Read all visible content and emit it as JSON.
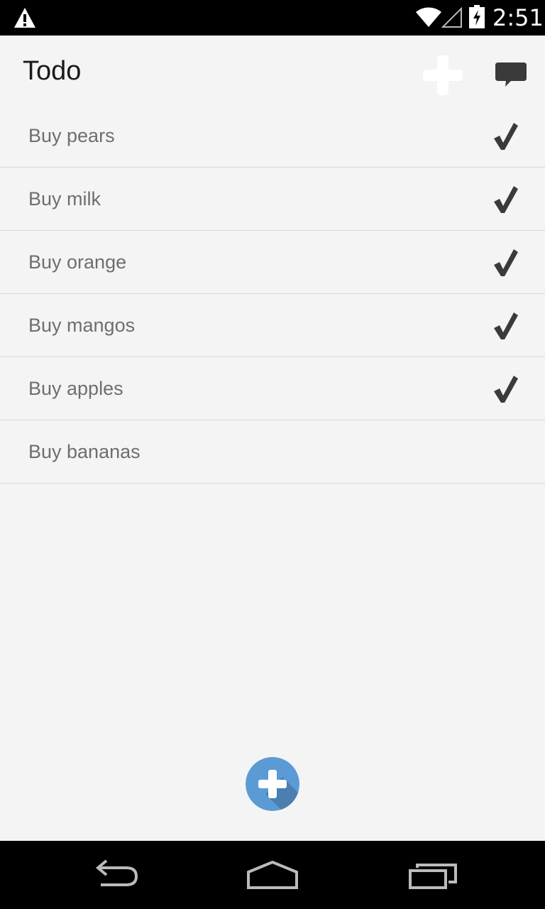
{
  "status_bar": {
    "time": "2:51",
    "icons": [
      "warning-icon",
      "wifi-icon",
      "signal-icon",
      "battery-charging-icon"
    ]
  },
  "action_bar": {
    "title": "Todo",
    "actions": [
      "add-icon",
      "chat-bubble-icon"
    ]
  },
  "todos": [
    {
      "label": "Buy pears",
      "done": true
    },
    {
      "label": "Buy milk",
      "done": true
    },
    {
      "label": "Buy orange",
      "done": true
    },
    {
      "label": "Buy mangos",
      "done": true
    },
    {
      "label": "Buy apples",
      "done": true
    },
    {
      "label": "Buy bananas",
      "done": false
    }
  ],
  "fab": {
    "icon": "add-circle-icon",
    "color": "#5b9bd5"
  },
  "nav_bar": {
    "buttons": [
      "back-icon",
      "home-icon",
      "recent-apps-icon"
    ]
  },
  "colors": {
    "background": "#f4f4f4",
    "status_bar": "#000000",
    "item_text": "#6e6e6e",
    "divider": "#d8d8d8",
    "check": "#3a3a3a"
  }
}
